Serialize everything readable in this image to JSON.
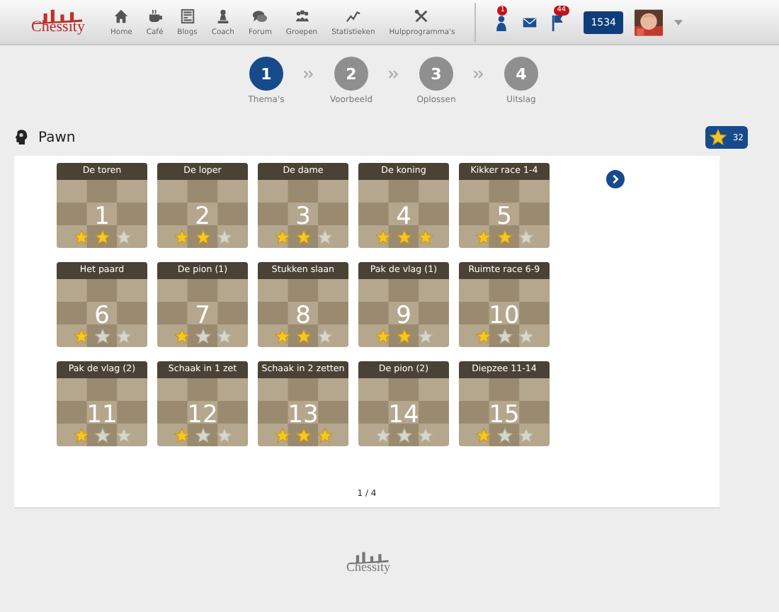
{
  "logo": "Chessity",
  "nav": [
    {
      "label": "Home",
      "kind": "home"
    },
    {
      "label": "Café",
      "kind": "cup"
    },
    {
      "label": "Blogs",
      "kind": "blog"
    },
    {
      "label": "Coach",
      "kind": "pawn"
    },
    {
      "label": "Forum",
      "kind": "chat"
    },
    {
      "label": "Groepen",
      "kind": "group"
    },
    {
      "label": "Statistieken",
      "kind": "chart"
    },
    {
      "label": "Hulpprogramma's",
      "kind": "tools"
    }
  ],
  "notifications": [
    {
      "kind": "person",
      "badge": "1"
    },
    {
      "kind": "mail"
    },
    {
      "kind": "flag",
      "badge": "44"
    }
  ],
  "rating": "1534",
  "steps": [
    {
      "number": "1",
      "label": "Thema's",
      "selected": true
    },
    {
      "number": "2",
      "label": "Voorbeeld",
      "selected": false
    },
    {
      "number": "3",
      "label": "Oplossen",
      "selected": false
    },
    {
      "number": "4",
      "label": "Uitslag",
      "selected": false
    }
  ],
  "section": {
    "title": "Pawn",
    "star_count": "32"
  },
  "tiles": [
    {
      "title": "De toren",
      "number": "1",
      "stars": 2
    },
    {
      "title": "De loper",
      "number": "2",
      "stars": 2
    },
    {
      "title": "De dame",
      "number": "3",
      "stars": 2
    },
    {
      "title": "De koning",
      "number": "4",
      "stars": 3
    },
    {
      "title": "Kikker race 1-4",
      "number": "5",
      "stars": 2
    },
    {
      "title": "Het paard",
      "number": "6",
      "stars": 1
    },
    {
      "title": "De pion (1)",
      "number": "7",
      "stars": 1
    },
    {
      "title": "Stukken slaan",
      "number": "8",
      "stars": 2
    },
    {
      "title": "Pak de vlag (1)",
      "number": "9",
      "stars": 2
    },
    {
      "title": "Ruimte race 6-9",
      "number": "10",
      "stars": 1
    },
    {
      "title": "Pak de vlag (2)",
      "number": "11",
      "stars": 1
    },
    {
      "title": "Schaak in 1 zet",
      "number": "12",
      "stars": 1
    },
    {
      "title": "Schaak in 2 zetten",
      "number": "13",
      "stars": 3
    },
    {
      "title": "De pion (2)",
      "number": "14",
      "stars": 0
    },
    {
      "title": "Diepzee 11-14",
      "number": "15",
      "stars": 1
    }
  ],
  "pagination": "1 / 4",
  "footer_logo": "Chessity"
}
